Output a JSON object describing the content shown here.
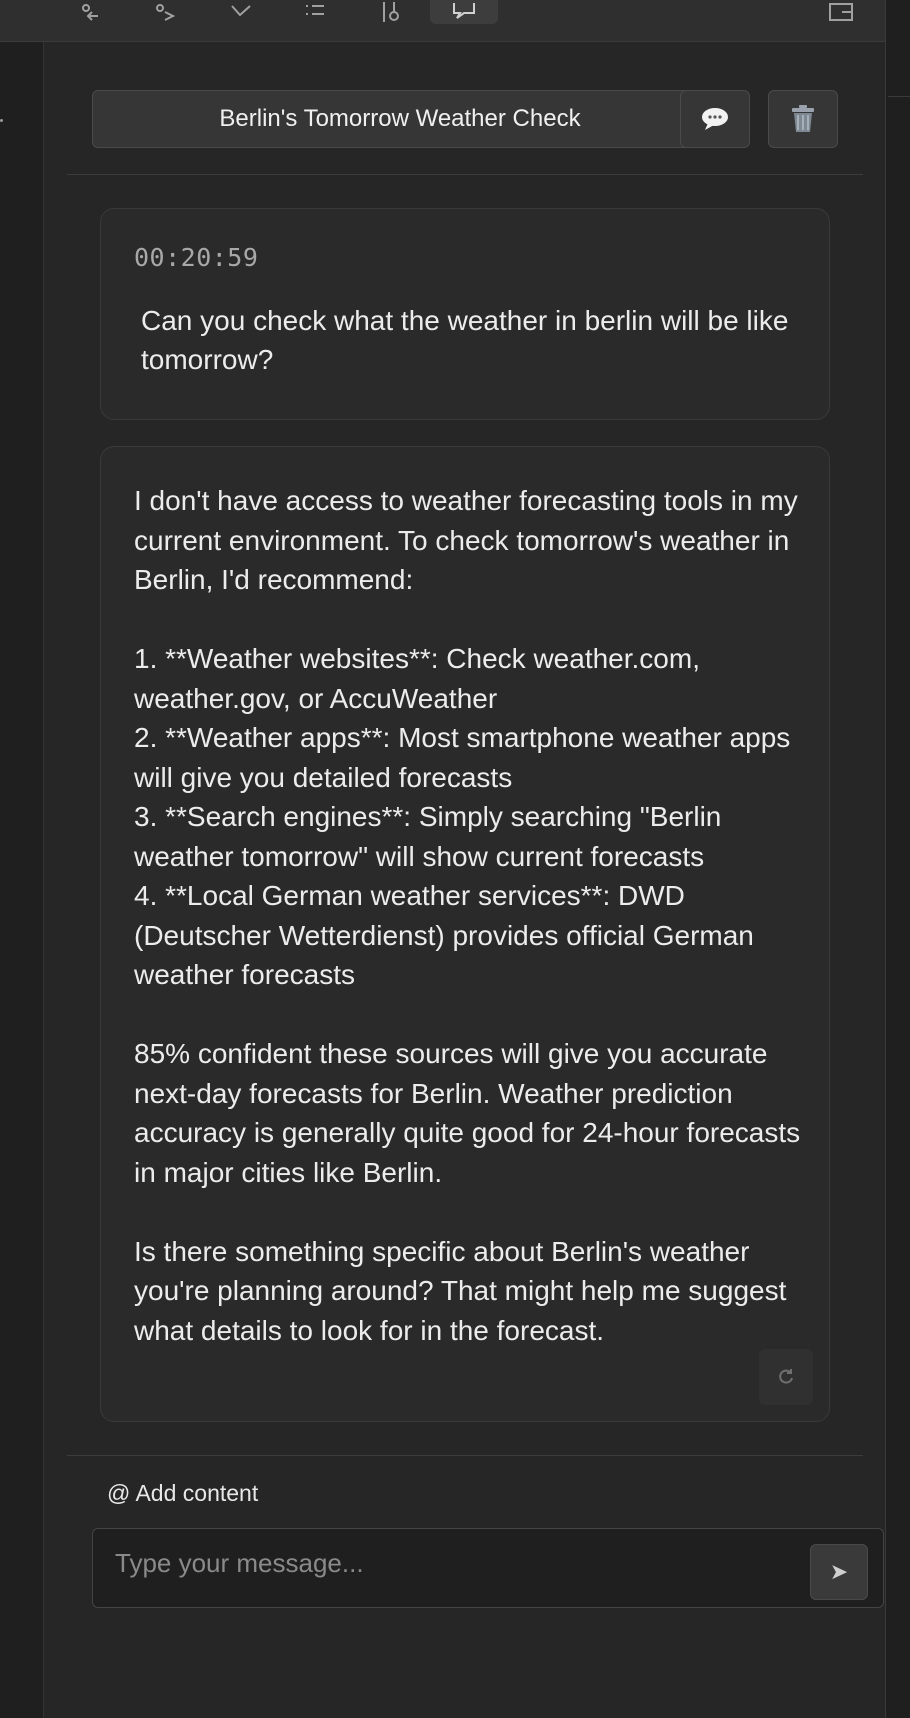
{
  "conversation": {
    "title": "Berlin's Tomorrow Weather Check"
  },
  "icons": {
    "toolbar": [
      "git-compare-icon",
      "git-pull-icon",
      "tag-icon",
      "list-icon",
      "git-branch-icon",
      "chat-icon",
      "layout-panel-icon"
    ],
    "new_chat": "speech-bubble-icon",
    "delete": "trash-icon",
    "regenerate": "refresh-icon",
    "send": "send-icon"
  },
  "user_message": {
    "timestamp": "00:20:59",
    "text": "Can you check what the weather in berlin will be like tomorrow?"
  },
  "assistant_message": {
    "lines": [
      "I don't have access to weather forecasting tools in my current environment. To check tomorrow's weather in Berlin, I'd recommend:",
      "",
      "1. **Weather websites**: Check weather.com, weather.gov, or AccuWeather",
      "2. **Weather apps**: Most smartphone weather apps will give you detailed forecasts",
      "3. **Search engines**: Simply searching \"Berlin weather tomorrow\" will show current forecasts",
      "4. **Local German weather services**: DWD (Deutscher Wetterdienst) provides official German weather forecasts",
      "",
      "85% confident these sources will give you accurate next-day forecasts for Berlin. Weather prediction accuracy is generally quite good for 24-hour forecasts in major cities like Berlin.",
      "",
      "Is there something specific about Berlin's weather you're planning around? That might help me suggest what details to look for in the forecast."
    ]
  },
  "composer": {
    "add_content_label": "@ Add content",
    "placeholder": "Type your message...",
    "value": "",
    "send_glyph": "➤"
  },
  "colors": {
    "background": "#262626",
    "panel": "#2a2a2a",
    "button": "#363636",
    "text": "#ececec",
    "muted": "#a8a8a8"
  }
}
